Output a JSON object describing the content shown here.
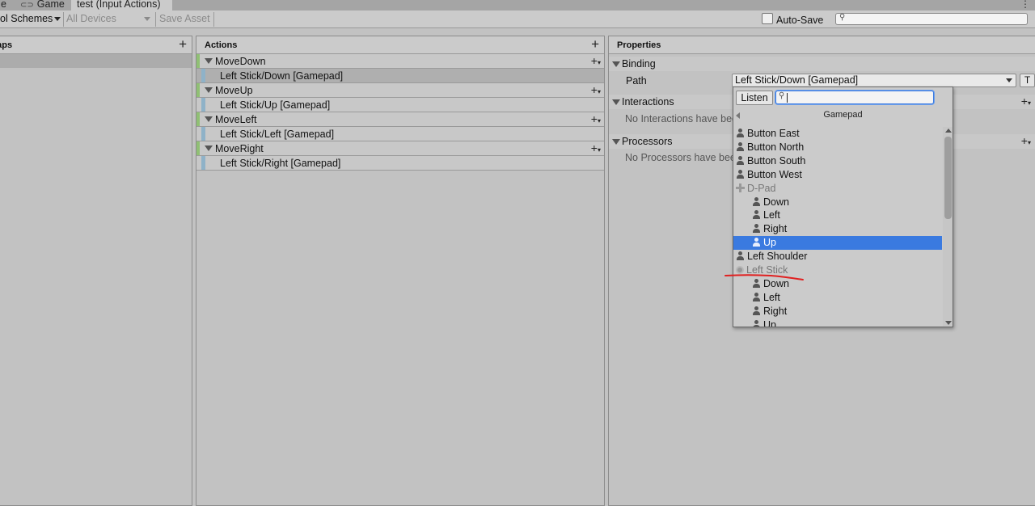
{
  "tabs": [
    {
      "label": "e",
      "icon": ""
    },
    {
      "label": "Game",
      "icon": "gamepad-icon"
    },
    {
      "label": "test (Input Actions)",
      "icon": ""
    }
  ],
  "toolbar": {
    "control_schemes": "ol Schemes",
    "devices": "All Devices",
    "save_asset": "Save Asset",
    "auto_save_label": "Auto-Save",
    "auto_save_checked": false,
    "search_placeholder": ""
  },
  "maps_panel": {
    "title": "Maps"
  },
  "actions_panel": {
    "title": "Actions",
    "actions": [
      {
        "name": "MoveDown",
        "binding": "Left Stick/Down [Gamepad]",
        "selected": true
      },
      {
        "name": "MoveUp",
        "binding": "Left Stick/Up [Gamepad]",
        "selected": false
      },
      {
        "name": "MoveLeft",
        "binding": "Left Stick/Left [Gamepad]",
        "selected": false
      },
      {
        "name": "MoveRight",
        "binding": "Left Stick/Right [Gamepad]",
        "selected": false
      }
    ]
  },
  "properties_panel": {
    "title": "Properties",
    "binding_section": "Binding",
    "path_label": "Path",
    "path_value": "Left Stick/Down [Gamepad]",
    "t_button": "T",
    "interactions_section": "Interactions",
    "interactions_empty": "No Interactions have bee",
    "processors_section": "Processors",
    "processors_empty": "No Processors have bee"
  },
  "path_dropdown": {
    "listen_label": "Listen",
    "search_value": "",
    "title": "Gamepad",
    "items": [
      {
        "label": "Button East",
        "icon": "person-icon",
        "indent": 0,
        "state": "normal"
      },
      {
        "label": "Button North",
        "icon": "person-icon",
        "indent": 0,
        "state": "normal"
      },
      {
        "label": "Button South",
        "icon": "person-icon",
        "indent": 0,
        "state": "normal"
      },
      {
        "label": "Button West",
        "icon": "person-icon",
        "indent": 0,
        "state": "normal"
      },
      {
        "label": "D-Pad",
        "icon": "dpad-icon",
        "indent": 0,
        "state": "group"
      },
      {
        "label": "Down",
        "icon": "person-icon",
        "indent": 1,
        "state": "normal"
      },
      {
        "label": "Left",
        "icon": "person-icon",
        "indent": 1,
        "state": "normal"
      },
      {
        "label": "Right",
        "icon": "person-icon",
        "indent": 1,
        "state": "normal"
      },
      {
        "label": "Up",
        "icon": "person-icon",
        "indent": 1,
        "state": "selected"
      },
      {
        "label": "Left Shoulder",
        "icon": "person-icon",
        "indent": 0,
        "state": "normal"
      },
      {
        "label": "Left Stick",
        "icon": "stick-icon",
        "indent": 0,
        "state": "group"
      },
      {
        "label": "Down",
        "icon": "person-icon",
        "indent": 1,
        "state": "normal"
      },
      {
        "label": "Left",
        "icon": "person-icon",
        "indent": 1,
        "state": "normal"
      },
      {
        "label": "Right",
        "icon": "person-icon",
        "indent": 1,
        "state": "normal"
      },
      {
        "label": "Up",
        "icon": "person-icon",
        "indent": 1,
        "state": "normal"
      }
    ]
  },
  "colors": {
    "selection": "#3a7ae0",
    "action_bar": "#90c074",
    "binding_bar": "#8fb2c8",
    "annotation": "#e02020"
  }
}
